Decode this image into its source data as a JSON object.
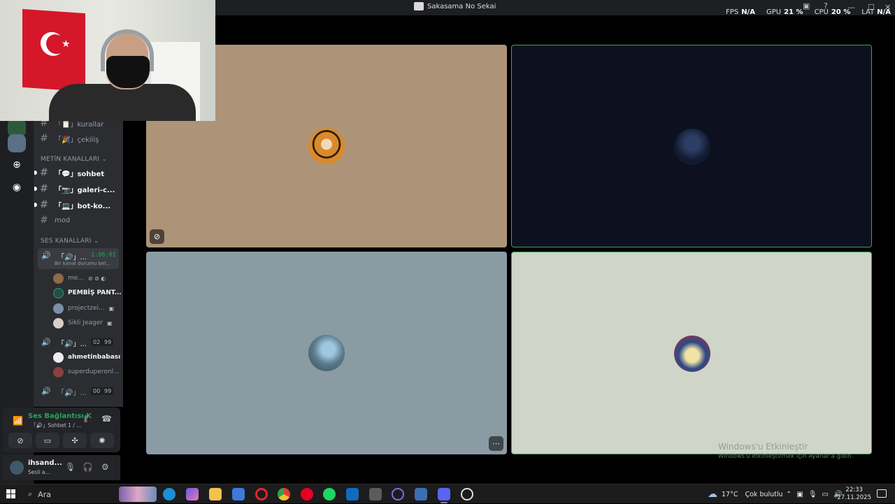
{
  "window": {
    "title": "Sakasama No Sekai"
  },
  "stats": [
    {
      "label": "FPS",
      "value": "N/A"
    },
    {
      "label": "GPU",
      "value": "21 %"
    },
    {
      "label": "CPU",
      "value": "20 %"
    },
    {
      "label": "LAT",
      "value": "N/A"
    }
  ],
  "channels": {
    "text_top": [
      {
        "label": "「📋」kurallar"
      },
      {
        "label": "「🎉」çekiliş"
      }
    ],
    "text_category": "METİN KANALLARI",
    "text": [
      {
        "label": "「💬」sohbet"
      },
      {
        "label": "「📷」galeri-c..."
      },
      {
        "label": "「💻」bot-ko..."
      },
      {
        "label": "mod"
      }
    ],
    "voice_category": "SES KANALLARI",
    "voice1": {
      "label": "「🔊」...",
      "time": "1:06:01",
      "status": "Bir kanal durumu bel..."
    },
    "voice1_users": [
      {
        "name": "me..."
      },
      {
        "name": "PEMBİŞ PANT..."
      },
      {
        "name": "projectzei..."
      },
      {
        "name": "Sikli Jeager"
      }
    ],
    "voice2": {
      "label": "「🔊」...",
      "count": "02",
      "limit": "99"
    },
    "voice2_users": [
      {
        "name": "ahmetinbabası"
      },
      {
        "name": "superduperonl..."
      }
    ],
    "voice3": {
      "label": "「🔊」...",
      "count": "00",
      "limit": "99"
    }
  },
  "voice_panel": {
    "title": "Ses Bağlantısı K",
    "channel": "「🔊」Sohbet 1 / ..."
  },
  "user_panel": {
    "name": "ihsand...",
    "status": "Sesli a..."
  },
  "activate": {
    "line1": "Windows'u Etkinleştir",
    "line2": "Windows'u etkinleştirmek için Ayarlar'a gidin."
  },
  "taskbar": {
    "search": "Ara",
    "weather": "17°C",
    "weather_desc": "Çok bulutlu",
    "time": "22:33",
    "date": "27.11.2025"
  },
  "colors": {
    "accent_green": "#23a55a",
    "speaking_border": "#3ba55d",
    "tile1_bg": "#ad9479",
    "tile2_bg": "#0d111f",
    "tile3_bg": "#8a9ba3",
    "tile4_bg": "#cfd5c9"
  }
}
